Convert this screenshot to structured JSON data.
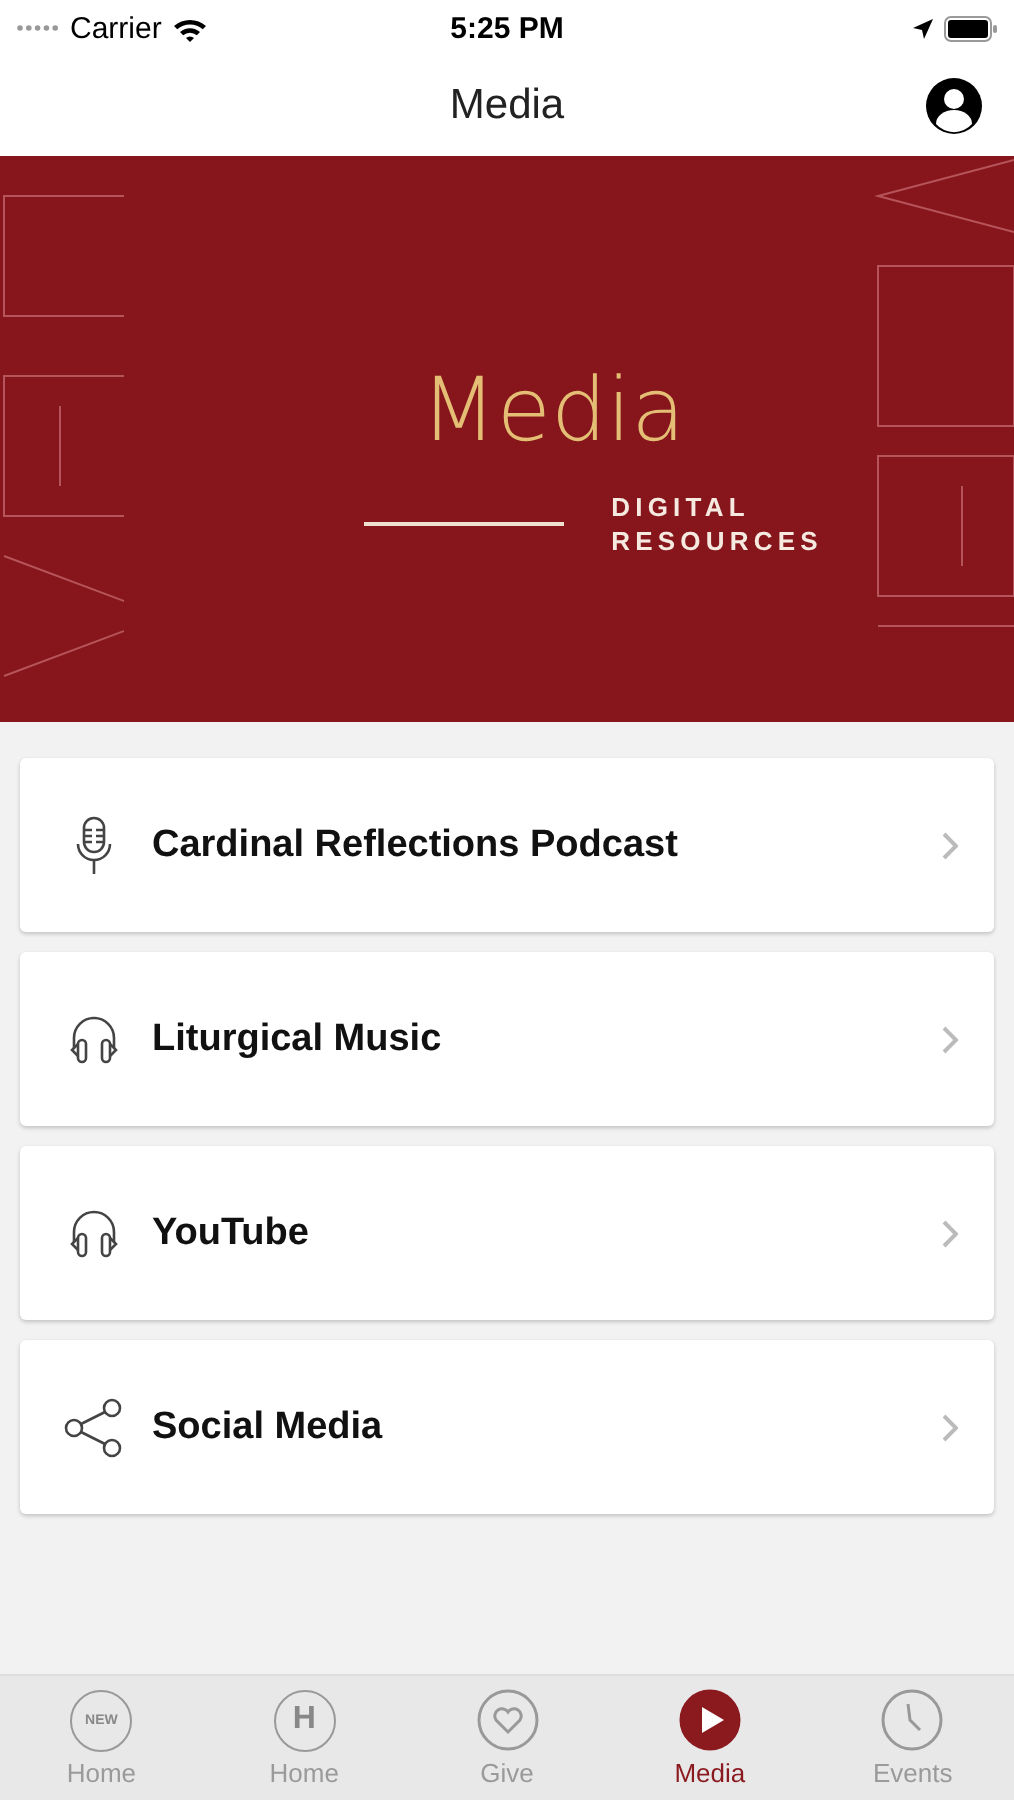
{
  "status_bar": {
    "carrier": "Carrier",
    "time": "5:25 PM"
  },
  "nav": {
    "title": "Media"
  },
  "banner": {
    "title": "Media",
    "subtitle_lines": [
      "DIGITAL",
      "RESOURCES"
    ]
  },
  "items": [
    {
      "label": "Cardinal Reflections Podcast",
      "kind": "mic"
    },
    {
      "label": "Liturgical Music",
      "kind": "headphones"
    },
    {
      "label": "YouTube",
      "kind": "headphones"
    },
    {
      "label": "Social Media",
      "kind": "share"
    }
  ],
  "tabs": [
    {
      "label": "Home",
      "kind": "badge",
      "icon_text": "NEW",
      "selected": false
    },
    {
      "label": "Home",
      "kind": "letter",
      "icon_text": "H",
      "selected": false
    },
    {
      "label": "Give",
      "kind": "heart",
      "selected": false
    },
    {
      "label": "Media",
      "kind": "play",
      "selected": true
    },
    {
      "label": "Events",
      "kind": "clock",
      "selected": false
    }
  ]
}
